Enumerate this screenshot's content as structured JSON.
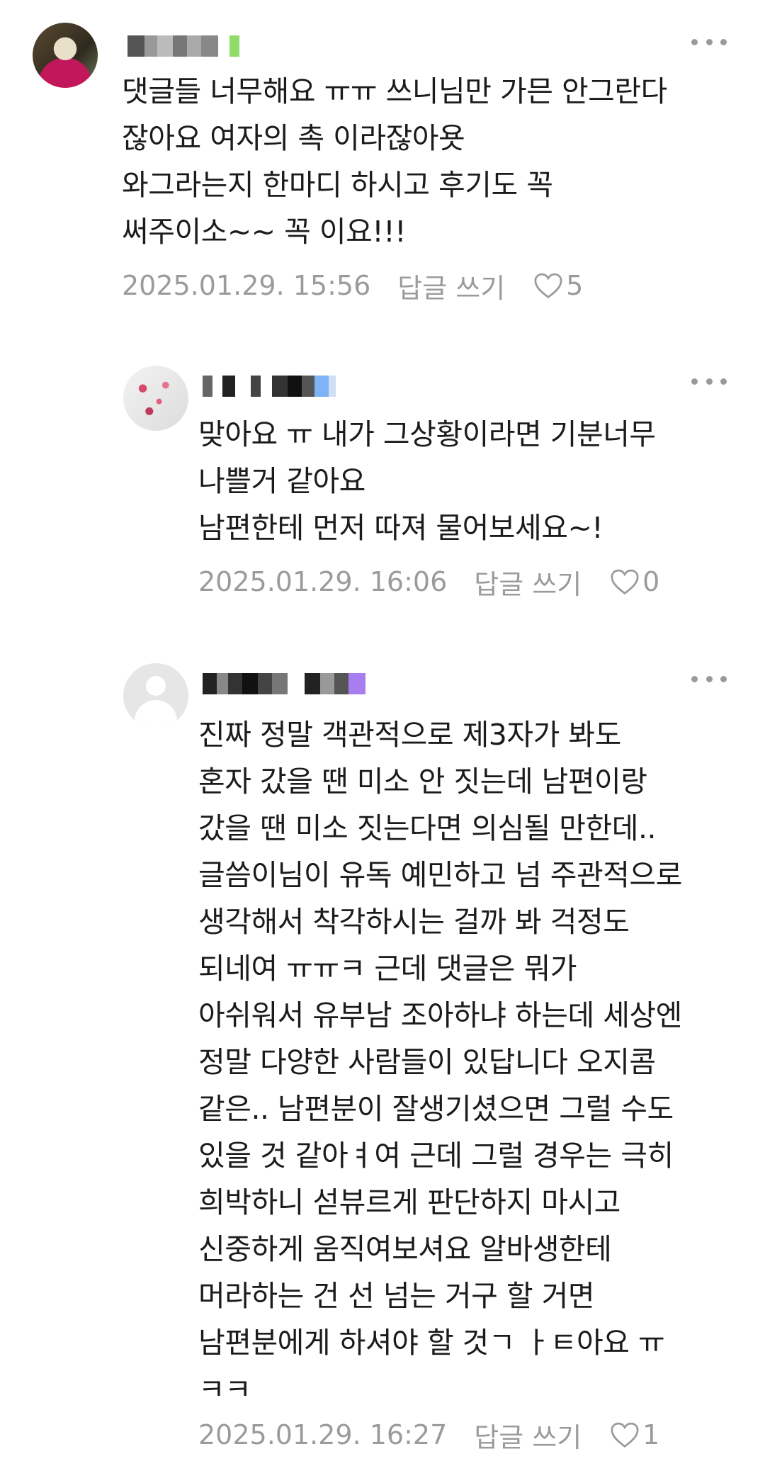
{
  "comments": [
    {
      "lines": [
        "댓글들 너무해요 ㅠㅠ 쓰니님만 가믄 안그란다",
        "잖아요 여자의 촉 이라잖아욧",
        "와그라는지 한마디 하시고 후기도 꼭",
        "써주이소~~ 꼭 이요!!!"
      ],
      "date": "2025.01.29. 15:56",
      "reply_label": "답글 쓰기",
      "like_count": "5"
    },
    {
      "lines": [
        "맞아요 ㅠ 내가 그상황이라면 기분너무",
        "나쁠거 같아요",
        "남편한테 먼저 따져 물어보세요~!"
      ],
      "date": "2025.01.29. 16:06",
      "reply_label": "답글 쓰기",
      "like_count": "0"
    },
    {
      "lines": [
        "진짜 정말 객관적으로 제3자가 봐도",
        "혼자 갔을 땐 미소 안 짓는데 남편이랑",
        "갔을 땐 미소 짓는다면 의심될 만한데..",
        "글씀이님이 유독 예민하고 넘 주관적으로",
        "생각해서 착각하시는 걸까 봐 걱정도",
        "되네여 ㅠㅠㅋ 근데 댓글은 뭐가",
        "아쉬워서 유부남 조아하냐 하는데 세상엔",
        "정말 다양한 사람들이 있답니다 오지콤",
        "같은.. 남편분이 잘생기셨으면 그럴 수도",
        "있을 것 같아ㅕ여 근데 그럴 경우는 극히",
        "희박하니 섣뷰르게 판단하지 마시고",
        "신중하게 움직여보셔요 알바생한테",
        "머라하는 건 선 넘는 거구 할 거면",
        "남편분에게 하셔야 할 것ㄱ ㅏㅌ아요 ㅠ",
        "ㅋㅋ"
      ],
      "date": "2025.01.29. 16:27",
      "reply_label": "답글 쓰기",
      "like_count": "1"
    }
  ],
  "icons": {
    "more": "more-horizontal-icon",
    "like": "heart-outline-icon"
  },
  "colors": {
    "text": "#1b1b1b",
    "meta": "#9b9b9b",
    "badge_green": "#8fdc6a",
    "badge_blue": "#7fb3f5",
    "badge_purple": "#a77df0"
  }
}
